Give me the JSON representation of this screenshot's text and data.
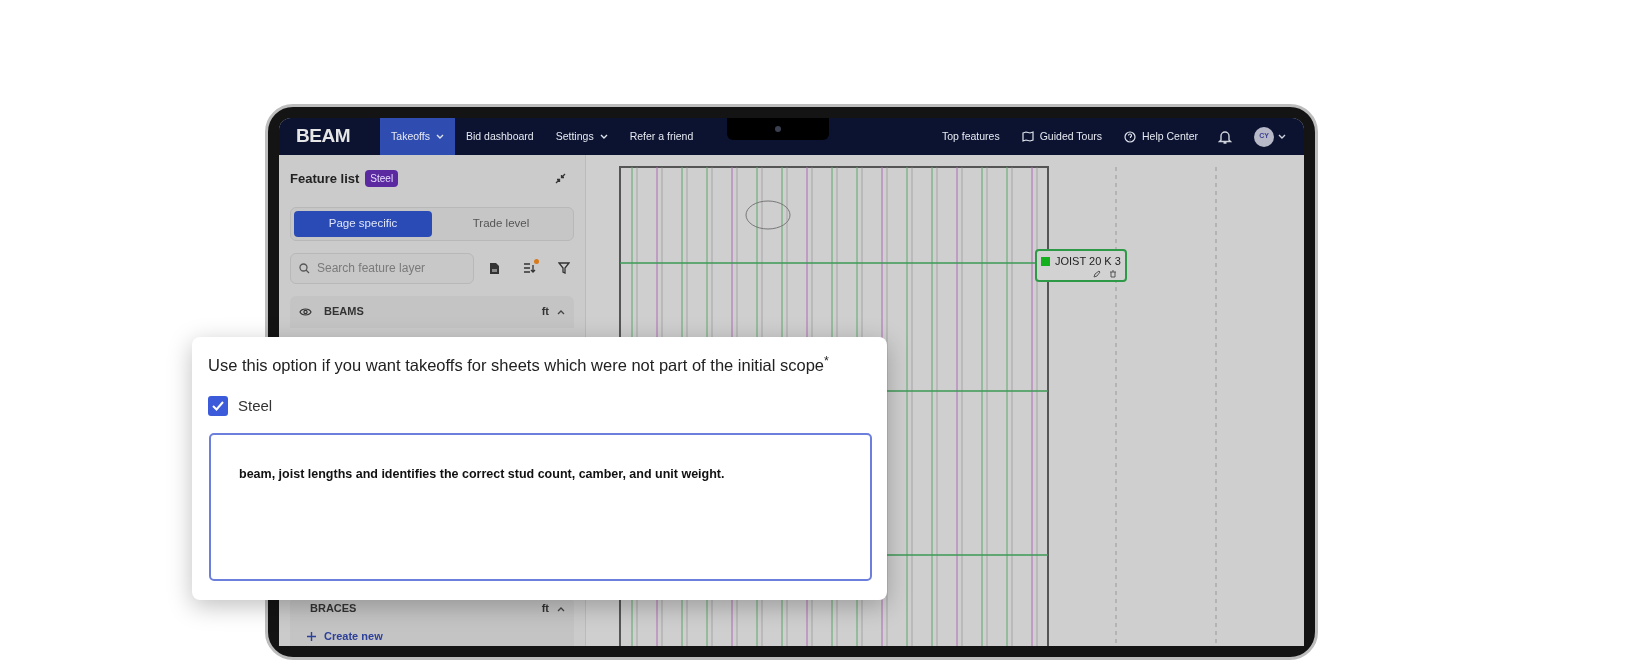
{
  "nav": {
    "logo": "BEAM",
    "items": [
      {
        "label": "Takeoffs",
        "selected": true,
        "dropdown": true
      },
      {
        "label": "Bid dashboard",
        "selected": false,
        "dropdown": false
      },
      {
        "label": "Settings",
        "selected": false,
        "dropdown": true
      },
      {
        "label": "Refer a friend",
        "selected": false,
        "dropdown": false
      }
    ],
    "right": [
      {
        "kind": "text",
        "label": "Top features"
      },
      {
        "kind": "map",
        "label": "Guided Tours"
      },
      {
        "kind": "help",
        "label": "Help Center"
      }
    ],
    "avatar": "CY"
  },
  "sidebar": {
    "title": "Feature list",
    "badge": "Steel",
    "tabs": [
      {
        "label": "Page specific",
        "selected": true
      },
      {
        "label": "Trade level",
        "selected": false
      }
    ],
    "search": {
      "placeholder": "Search feature layer"
    },
    "sort_indicator": true,
    "layers": [
      {
        "name": "BEAMS",
        "unit": "ft",
        "expanded": true
      },
      {
        "name": "BRACES",
        "unit": "ft",
        "expanded": true
      }
    ],
    "create_new": "Create new"
  },
  "canvas": {
    "tag": {
      "label": "JOIST 20 K 3"
    }
  },
  "popup": {
    "prompt": "Use this option if you want takeoffs for sheets which were not part of the initial scope$^{*}$",
    "option": {
      "label": "Steel",
      "checked": true
    },
    "notes": {
      "value": "beam, joist lengths and identifies the correct stud count, camber, and unit weight."
    }
  }
}
